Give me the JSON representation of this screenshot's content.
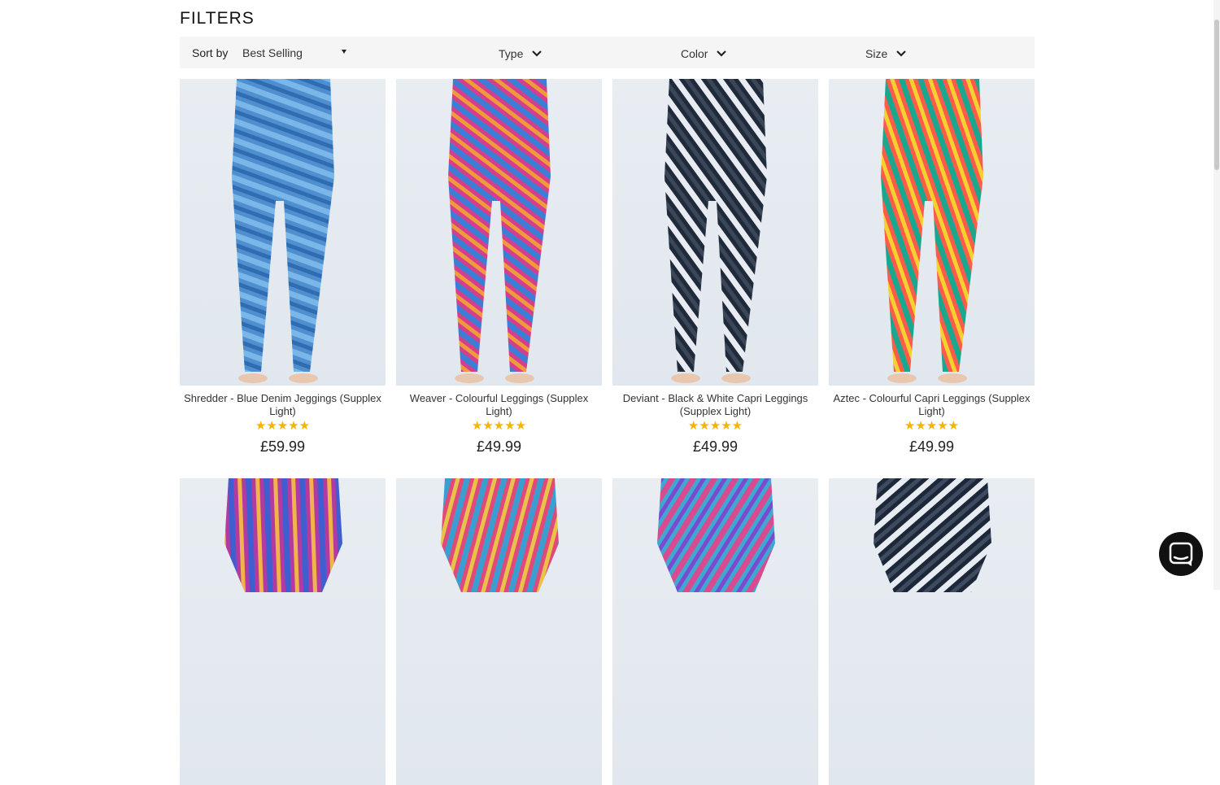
{
  "filters": {
    "title": "FILTERS",
    "sort_label": "Sort by",
    "sort_value": "Best Selling",
    "type_label": "Type",
    "color_label": "Color",
    "size_label": "Size"
  },
  "products": [
    {
      "name": "Shredder - Blue Denim Jeggings (Supplex Light)",
      "rating": 5,
      "stars": "★★★★★",
      "price": "£59.99",
      "palette": [
        "#4f8fd0",
        "#7bb6e8",
        "#2f6cb0"
      ]
    },
    {
      "name": "Weaver - Colourful Leggings (Supplex Light)",
      "rating": 5,
      "stars": "★★★★★",
      "price": "£49.99",
      "palette": [
        "#d43f8d",
        "#3a7fd5",
        "#f09a3a"
      ]
    },
    {
      "name": "Deviant - Black & White Capri Leggings (Supplex Light)",
      "rating": 5,
      "stars": "★★★★★",
      "price": "£49.99",
      "palette": [
        "#1f2a3a",
        "#e8ecf2",
        "#3b4658"
      ]
    },
    {
      "name": "Aztec - Colourful Capri Leggings (Supplex Light)",
      "rating": 5,
      "stars": "★★★★★",
      "price": "£49.99",
      "palette": [
        "#ff5b4a",
        "#19a88f",
        "#f5d12f"
      ]
    },
    {
      "palette": [
        "#b33aa0",
        "#3f5fd0",
        "#f0b44a"
      ]
    },
    {
      "palette": [
        "#e04a7a",
        "#3a9fd0",
        "#e9c24a"
      ]
    },
    {
      "palette": [
        "#3fa7d0",
        "#d94a8f",
        "#7b4ad0"
      ]
    },
    {
      "palette": [
        "#1c2738",
        "#e7ecf3",
        "#3d4a60"
      ]
    }
  ],
  "colors": {
    "star": "#f4b400",
    "filter_bg": "#f5f5f5",
    "chat": "#111111"
  },
  "icons": {
    "chevron": "chevron-down-icon",
    "caret": "caret-down-icon",
    "chat": "chat-icon"
  }
}
